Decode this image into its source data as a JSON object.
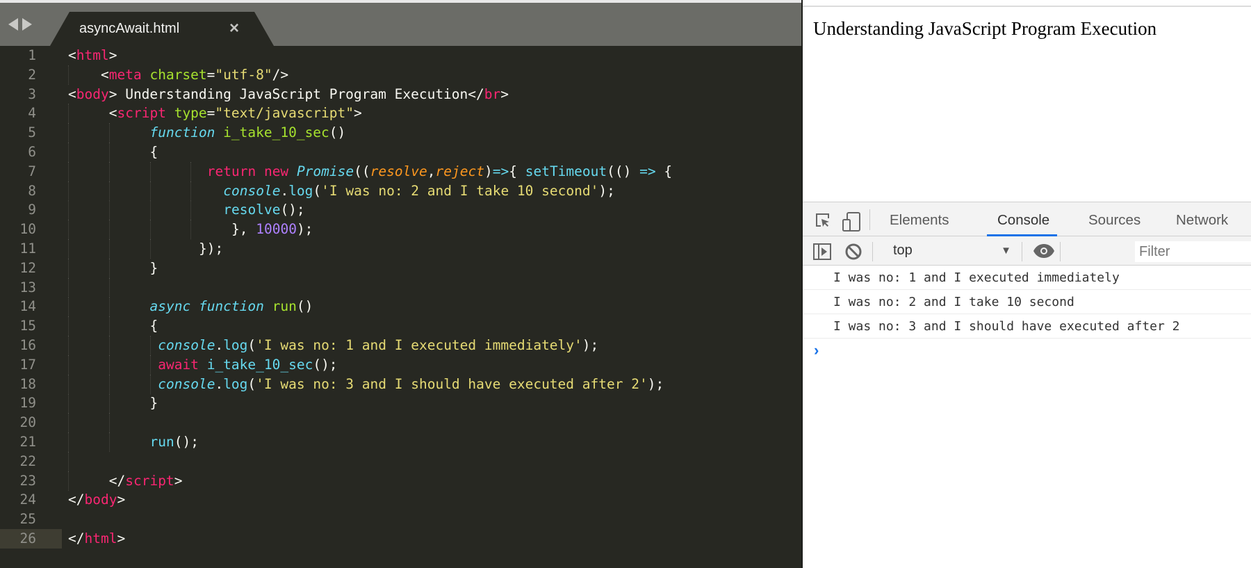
{
  "editor": {
    "tab_title": "asyncAwait.html",
    "current_line": 26,
    "lines": [
      {
        "n": "1",
        "indent": 0,
        "guides": [],
        "tokens": [
          [
            "plain",
            "<"
          ],
          [
            "tag",
            "html"
          ],
          [
            "plain",
            ">"
          ]
        ]
      },
      {
        "n": "2",
        "indent": 4,
        "guides": [
          0
        ],
        "tokens": [
          [
            "plain",
            "<"
          ],
          [
            "tag",
            "meta"
          ],
          [
            "plain",
            " "
          ],
          [
            "attr",
            "charset"
          ],
          [
            "plain",
            "="
          ],
          [
            "str",
            "\"utf-8\""
          ],
          [
            "plain",
            "/>"
          ]
        ]
      },
      {
        "n": "3",
        "indent": 0,
        "guides": [],
        "tokens": [
          [
            "plain",
            "<"
          ],
          [
            "tag",
            "body"
          ],
          [
            "plain",
            "> Understanding JavaScript Program Execution</"
          ],
          [
            "tag",
            "br"
          ],
          [
            "plain",
            ">"
          ]
        ]
      },
      {
        "n": "4",
        "indent": 5,
        "guides": [
          0
        ],
        "tokens": [
          [
            "plain",
            "<"
          ],
          [
            "tag",
            "script"
          ],
          [
            "plain",
            " "
          ],
          [
            "attr",
            "type"
          ],
          [
            "plain",
            "="
          ],
          [
            "str",
            "\"text/javascript\""
          ],
          [
            "plain",
            ">"
          ]
        ]
      },
      {
        "n": "5",
        "indent": 10,
        "guides": [
          0,
          5
        ],
        "tokens": [
          [
            "kw",
            "function"
          ],
          [
            "plain",
            " "
          ],
          [
            "fn",
            "i_take_10_sec"
          ],
          [
            "plain",
            "()"
          ]
        ]
      },
      {
        "n": "6",
        "indent": 10,
        "guides": [
          0,
          5
        ],
        "tokens": [
          [
            "plain",
            "{"
          ]
        ]
      },
      {
        "n": "7",
        "indent": 17,
        "guides": [
          0,
          5,
          10,
          15
        ],
        "tokens": [
          [
            "ctl",
            "return"
          ],
          [
            "plain",
            " "
          ],
          [
            "ctl",
            "new"
          ],
          [
            "plain",
            " "
          ],
          [
            "cls",
            "Promise"
          ],
          [
            "plain",
            "(("
          ],
          [
            "param",
            "resolve"
          ],
          [
            "plain",
            ","
          ],
          [
            "param",
            "reject"
          ],
          [
            "plain",
            ")"
          ],
          [
            "call",
            "=>"
          ],
          [
            "plain",
            "{ "
          ],
          [
            "call",
            "setTimeout"
          ],
          [
            "plain",
            "(() "
          ],
          [
            "call",
            "=>"
          ],
          [
            "plain",
            " {"
          ]
        ]
      },
      {
        "n": "8",
        "indent": 19,
        "guides": [
          0,
          5,
          10,
          15
        ],
        "tokens": [
          [
            "obj",
            "console"
          ],
          [
            "plain",
            "."
          ],
          [
            "call",
            "log"
          ],
          [
            "plain",
            "("
          ],
          [
            "str",
            "'I was no: 2 and I take 10 second'"
          ],
          [
            "plain",
            ");"
          ]
        ]
      },
      {
        "n": "9",
        "indent": 19,
        "guides": [
          0,
          5,
          10,
          15
        ],
        "tokens": [
          [
            "call",
            "resolve"
          ],
          [
            "plain",
            "();"
          ]
        ]
      },
      {
        "n": "10",
        "indent": 20,
        "guides": [
          0,
          5,
          10,
          15
        ],
        "tokens": [
          [
            "plain",
            "}, "
          ],
          [
            "num",
            "10000"
          ],
          [
            "plain",
            ");"
          ]
        ]
      },
      {
        "n": "11",
        "indent": 16,
        "guides": [
          0,
          5,
          10
        ],
        "tokens": [
          [
            "plain",
            "});"
          ]
        ]
      },
      {
        "n": "12",
        "indent": 10,
        "guides": [
          0,
          5
        ],
        "tokens": [
          [
            "plain",
            "}"
          ]
        ]
      },
      {
        "n": "13",
        "indent": 0,
        "guides": [
          0,
          5
        ],
        "tokens": []
      },
      {
        "n": "14",
        "indent": 10,
        "guides": [
          0,
          5
        ],
        "tokens": [
          [
            "kw",
            "async"
          ],
          [
            "plain",
            " "
          ],
          [
            "kw",
            "function"
          ],
          [
            "plain",
            " "
          ],
          [
            "fn",
            "run"
          ],
          [
            "plain",
            "()"
          ]
        ]
      },
      {
        "n": "15",
        "indent": 10,
        "guides": [
          0,
          5
        ],
        "tokens": [
          [
            "plain",
            "{"
          ]
        ]
      },
      {
        "n": "16",
        "indent": 11,
        "guides": [
          0,
          5,
          10
        ],
        "tokens": [
          [
            "obj",
            "console"
          ],
          [
            "plain",
            "."
          ],
          [
            "call",
            "log"
          ],
          [
            "plain",
            "("
          ],
          [
            "str",
            "'I was no: 1 and I executed immediately'"
          ],
          [
            "plain",
            ");"
          ]
        ]
      },
      {
        "n": "17",
        "indent": 11,
        "guides": [
          0,
          5,
          10
        ],
        "tokens": [
          [
            "ctl",
            "await"
          ],
          [
            "plain",
            " "
          ],
          [
            "call",
            "i_take_10_sec"
          ],
          [
            "plain",
            "();"
          ]
        ]
      },
      {
        "n": "18",
        "indent": 11,
        "guides": [
          0,
          5,
          10
        ],
        "tokens": [
          [
            "obj",
            "console"
          ],
          [
            "plain",
            "."
          ],
          [
            "call",
            "log"
          ],
          [
            "plain",
            "("
          ],
          [
            "str",
            "'I was no: 3 and I should have executed after 2'"
          ],
          [
            "plain",
            ");"
          ]
        ]
      },
      {
        "n": "19",
        "indent": 10,
        "guides": [
          0,
          5
        ],
        "tokens": [
          [
            "plain",
            "}"
          ]
        ]
      },
      {
        "n": "20",
        "indent": 0,
        "guides": [
          0,
          5
        ],
        "tokens": []
      },
      {
        "n": "21",
        "indent": 10,
        "guides": [
          0,
          5
        ],
        "tokens": [
          [
            "call",
            "run"
          ],
          [
            "plain",
            "();"
          ]
        ]
      },
      {
        "n": "22",
        "indent": 0,
        "guides": [
          0
        ],
        "tokens": []
      },
      {
        "n": "23",
        "indent": 5,
        "guides": [
          0
        ],
        "tokens": [
          [
            "plain",
            "</"
          ],
          [
            "tag",
            "script"
          ],
          [
            "plain",
            ">"
          ]
        ]
      },
      {
        "n": "24",
        "indent": 0,
        "guides": [],
        "tokens": [
          [
            "plain",
            "</"
          ],
          [
            "tag",
            "body"
          ],
          [
            "plain",
            ">"
          ]
        ]
      },
      {
        "n": "25",
        "indent": 0,
        "guides": [],
        "tokens": []
      },
      {
        "n": "26",
        "indent": 0,
        "guides": [],
        "tokens": [
          [
            "plain",
            "</"
          ],
          [
            "tag",
            "html"
          ],
          [
            "plain",
            ">"
          ]
        ]
      }
    ]
  },
  "browser": {
    "page_text": "Understanding JavaScript Program Execution"
  },
  "devtools": {
    "tabs": [
      {
        "label": "Elements",
        "active": false
      },
      {
        "label": "Console",
        "active": true
      },
      {
        "label": "Sources",
        "active": false
      },
      {
        "label": "Network",
        "active": false
      }
    ],
    "context": "top",
    "filter_placeholder": "Filter",
    "accent_color": "#1a73e8",
    "console_messages": [
      "I was no: 1 and I executed immediately",
      "I was no: 2 and I take 10 second",
      "I was no: 3 and I should have executed after 2"
    ],
    "prompt_symbol": "›"
  }
}
